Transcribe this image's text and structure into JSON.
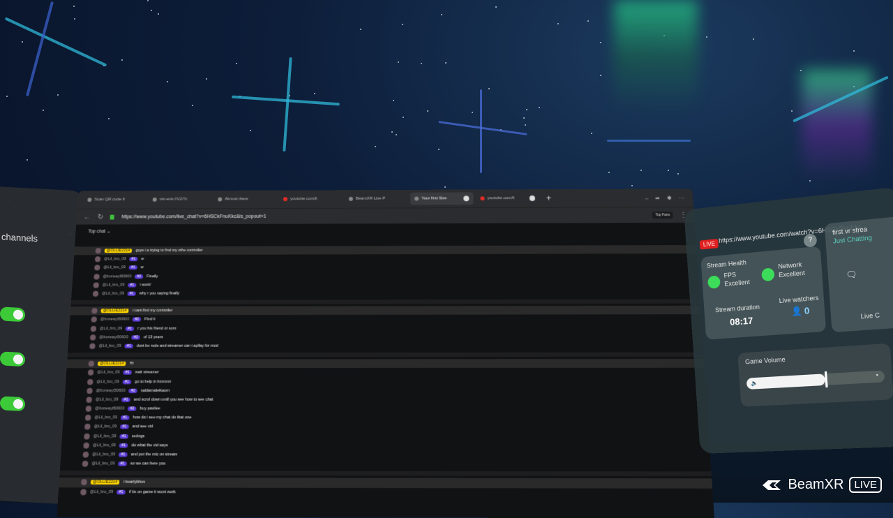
{
  "left_panel": {
    "title": "channels",
    "toggles": [
      true,
      true,
      true
    ]
  },
  "browser": {
    "tabs": [
      {
        "label": "Scan QR code fr",
        "active": false
      },
      {
        "label": "vsr-enk://V2/7c",
        "active": false
      },
      {
        "label": "Almost there",
        "active": false
      },
      {
        "label": "youtube.com/li",
        "active": false
      },
      {
        "label": "BeamXR Live P",
        "active": false
      },
      {
        "label": "Your first Stre",
        "active": true
      },
      {
        "label": "youtube.com/li",
        "active": false
      }
    ],
    "new_tab_label": "+",
    "url": "https://www.youtube.com/live_chat?v=6HSCkFnuKkc&is_popout=1",
    "top_button": "Top Fans",
    "chat_filter": "Top chat",
    "messages": [
      {
        "author": "@OLLIE2214",
        "owner": true,
        "badge": "",
        "text": "guys i a trying to find my othe controller",
        "highlight": true
      },
      {
        "author": "@Lil_bro_09",
        "owner": false,
        "badge": "#1",
        "text": "w",
        "highlight": false
      },
      {
        "author": "@Lil_bro_09",
        "owner": false,
        "badge": "#1",
        "text": "w",
        "highlight": false
      },
      {
        "author": "@boneayt50600",
        "owner": false,
        "badge": "#2",
        "text": "Finally",
        "highlight": false
      },
      {
        "author": "@Lil_bro_09",
        "owner": false,
        "badge": "#1",
        "text": "i work!",
        "highlight": false
      },
      {
        "author": "@Lil_bro_09",
        "owner": false,
        "badge": "#1",
        "text": "why r you saying finally",
        "highlight": false
      },
      {
        "author": "@OLLIE2214",
        "owner": true,
        "badge": "",
        "text": "i cant find my controller",
        "highlight": true
      },
      {
        "author": "@boneayt50600",
        "owner": false,
        "badge": "#2",
        "text": "Find it",
        "highlight": false
      },
      {
        "author": "@Lil_bro_09",
        "owner": false,
        "badge": "#1",
        "text": "r you his friend or som",
        "highlight": false
      },
      {
        "author": "@boneayt50600",
        "owner": false,
        "badge": "#2",
        "text": "of 13 years",
        "highlight": false
      },
      {
        "author": "@Lil_bro_09",
        "owner": false,
        "badge": "#1",
        "text": "dont be rude and streamer can i apllay for mod",
        "highlight": false
      },
      {
        "author": "@OLLIE2214",
        "owner": true,
        "badge": "",
        "text": "Hi",
        "highlight": true
      },
      {
        "author": "@Lil_bro_09",
        "owner": false,
        "badge": "#1",
        "text": "wait streamer",
        "highlight": false
      },
      {
        "author": "@Lil_bro_09",
        "owner": false,
        "badge": "#1",
        "text": "go to help in hmmrnr",
        "highlight": false
      },
      {
        "author": "@boneayt50600",
        "owner": false,
        "badge": "#2",
        "text": "saldamaleikaum",
        "highlight": false
      },
      {
        "author": "@Lil_bro_09",
        "owner": false,
        "badge": "#1",
        "text": "and scrol down until you see how to see chat",
        "highlight": false
      },
      {
        "author": "@boneayt50600",
        "owner": false,
        "badge": "#2",
        "text": "buy pavilee",
        "highlight": false
      },
      {
        "author": "@Lil_bro_09",
        "owner": false,
        "badge": "#1",
        "text": "how do i see my chat do that one",
        "highlight": false
      },
      {
        "author": "@Lil_bro_09",
        "owner": false,
        "badge": "#1",
        "text": "and see vid",
        "highlight": false
      },
      {
        "author": "@Lil_bro_09",
        "owner": false,
        "badge": "#1",
        "text": "setings",
        "highlight": false
      },
      {
        "author": "@Lil_bro_09",
        "owner": false,
        "badge": "#1",
        "text": "do what the vid says",
        "highlight": false
      },
      {
        "author": "@Lil_bro_09",
        "owner": false,
        "badge": "#1",
        "text": "and put the mic on stream",
        "highlight": false
      },
      {
        "author": "@Lil_bro_09",
        "owner": false,
        "badge": "#1",
        "text": "so we can here you",
        "highlight": false
      },
      {
        "author": "@OLLIE2214",
        "owner": true,
        "badge": "",
        "text": "i bearlybhes",
        "highlight": true
      },
      {
        "author": "@Lil_bro_09",
        "owner": false,
        "badge": "#1",
        "text": "if its on game it wont work",
        "highlight": false
      }
    ]
  },
  "stream_panel": {
    "live_label": "LIVE",
    "url": "https://www.youtube.com/watch?v=6HSCkFnuKkc",
    "help_label": "?",
    "stream_health_label": "Stream Health",
    "fps_label": "FPS",
    "fps_value": "Excellent",
    "network_label": "Network",
    "network_value": "Excellent",
    "duration_label": "Stream duration",
    "duration_value": "08:17",
    "watchers_label": "Live watchers",
    "watchers_value": "0",
    "side_title": "first vr strea",
    "side_subtitle": "Just Chatting",
    "side_live_label": "Live C",
    "volume_label": "Game Volume",
    "volume_level": 0.58,
    "volume_dot": "•"
  },
  "brand": {
    "name": "BeamXR",
    "live_badge": "LIVE"
  },
  "colors": {
    "accent_green": "#3cdc5a",
    "live_red": "#e02020",
    "badge_purple": "#5b3bd6",
    "owner_yellow": "#ffd600",
    "toggle_green": "#3fd23a",
    "cross_cyan": "#2fb8d8"
  }
}
